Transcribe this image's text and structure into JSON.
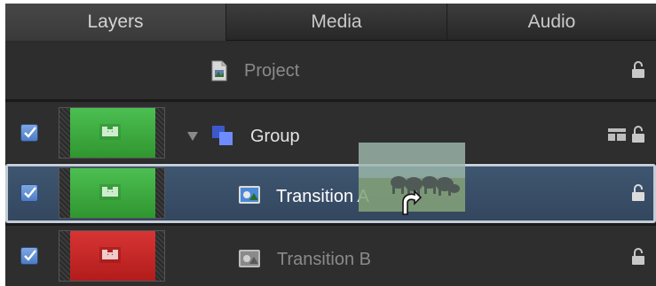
{
  "tabs": [
    {
      "label": "Layers",
      "active": true
    },
    {
      "label": "Media",
      "active": false
    },
    {
      "label": "Audio",
      "active": false
    }
  ],
  "layers": {
    "project": {
      "label": "Project",
      "icon": "project-file-icon",
      "locked": false
    },
    "group": {
      "label": "Group",
      "icon": "group-stack-icon",
      "expanded": true,
      "checked": true,
      "thumbnail_color": "#3fae45",
      "locked": false
    },
    "transition_a": {
      "label": "Transition A",
      "icon": "transition-icon",
      "checked": true,
      "selected": true,
      "thumbnail_color": "#3fae45",
      "locked": false
    },
    "transition_b": {
      "label": "Transition B",
      "icon": "transition-icon",
      "checked": true,
      "thumbnail_color": "#c62828",
      "locked": false
    }
  },
  "drag": {
    "thumbnail": "elephants-image-thumbnail",
    "cursor": "drop-cursor-icon"
  },
  "colors": {
    "accent": "#3d5a7f",
    "checkbox": "#5a8ad2",
    "text_primary": "#e0e0e0",
    "text_dimmed": "#8a8a8a"
  }
}
